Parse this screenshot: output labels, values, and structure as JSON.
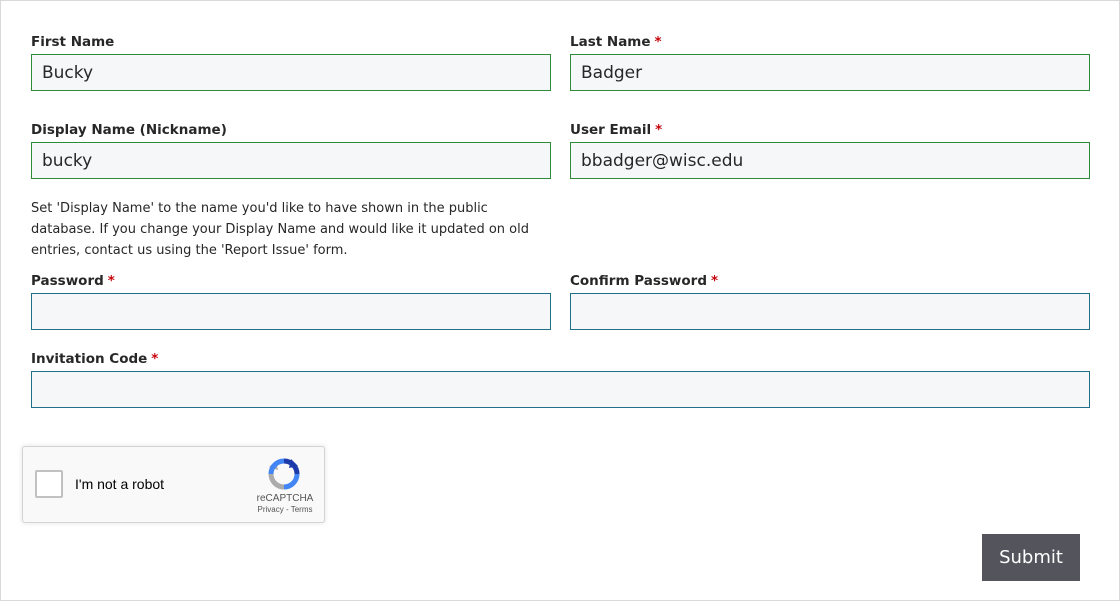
{
  "form": {
    "first_name": {
      "label": "First Name",
      "value": "Bucky"
    },
    "last_name": {
      "label": "Last Name",
      "required": "*",
      "value": "Badger"
    },
    "display_name": {
      "label": "Display Name (Nickname)",
      "value": "bucky"
    },
    "user_email": {
      "label": "User Email",
      "required": "*",
      "value": "bbadger@wisc.edu"
    },
    "display_name_help": "Set 'Display Name' to the name you'd like to have shown in the public database. If you change your Display Name and would like it updated on old entries, contact us using the 'Report Issue' form.",
    "password": {
      "label": "Password",
      "required": "*",
      "value": ""
    },
    "confirm_password": {
      "label": "Confirm Password",
      "required": "*",
      "value": ""
    },
    "invitation_code": {
      "label": "Invitation Code",
      "required": "*",
      "value": ""
    }
  },
  "recaptcha": {
    "checkbox_label": "I'm not a robot",
    "brand": "reCAPTCHA",
    "privacy": "Privacy",
    "separator": " - ",
    "terms": "Terms"
  },
  "submit_label": "Submit",
  "colors": {
    "required": "#c5050c",
    "valid_border": "#2e8b3a",
    "empty_border": "#1f6f86",
    "submit_bg": "#54545c"
  }
}
